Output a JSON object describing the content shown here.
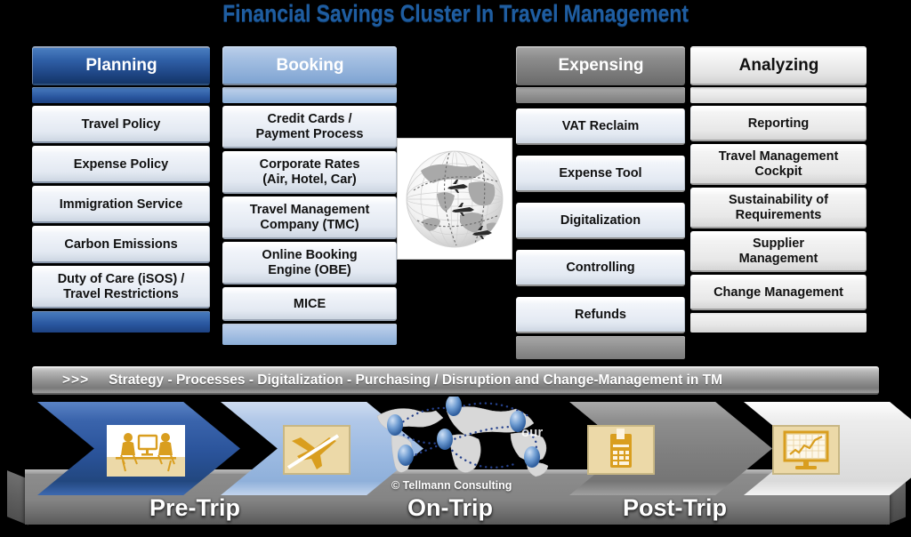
{
  "title": "Financial Savings Cluster In Travel Management",
  "columns": [
    {
      "key": "planning",
      "header": "Planning",
      "accent": "#2f5fa6",
      "items": [
        "Travel Policy",
        "Expense Policy",
        "Immigration Service",
        "Carbon Emissions",
        "Duty of Care (iSOS) /\nTravel Restrictions"
      ]
    },
    {
      "key": "booking",
      "header": "Booking",
      "accent": "#8fb0d9",
      "items": [
        "Credit Cards /\nPayment Process",
        "Corporate Rates\n(Air, Hotel, Car)",
        "Travel Management\nCompany (TMC)",
        "Online Booking\nEngine (OBE)",
        "MICE"
      ]
    },
    {
      "key": "expensing",
      "header": "Expensing",
      "accent": "#7a7a7a",
      "items": [
        "VAT Reclaim",
        "Expense Tool",
        "Digitalization",
        "Controlling",
        "Refunds"
      ]
    },
    {
      "key": "analyzing",
      "header": "Analyzing",
      "accent": "#e4e4e4",
      "items": [
        "Reporting",
        "Travel Management\nCockpit",
        "Sustainability of\nRequirements",
        "Supplier\nManagement",
        "Change Management"
      ]
    }
  ],
  "banner": {
    "arrows": ">>>",
    "text": "Strategy - Processes - Digitalization - Purchasing / Disruption and Change-Management in TM"
  },
  "globe": {
    "icon": "globe-airplanes-icon"
  },
  "phases": [
    {
      "key": "pre-trip",
      "label": "Pre-Trip",
      "color": "#2a539a",
      "icon": "meeting-table-icon"
    },
    {
      "key": "booking-flight",
      "label": "",
      "color": "#9cbae2",
      "icon": "airplane-icon"
    },
    {
      "key": "on-trip",
      "label": "On-Trip",
      "color": "transparent",
      "icon": "world-map-network-icon"
    },
    {
      "key": "expensing-phase",
      "label": "Post-Trip",
      "color": "#7f7f7f",
      "icon": "calculator-receipt-icon"
    },
    {
      "key": "analyzing-phase",
      "label": "",
      "color": "#e2e2e2",
      "icon": "monitor-chart-icon"
    }
  ],
  "copyright": "© Tellmann Consulting",
  "faded_text": "our",
  "colors": {
    "title": "#1F5DA0",
    "planning": "#2f5fa6",
    "booking": "#8fb0d9",
    "expensing": "#7a7a7a",
    "analyzing": "#e4e4e4",
    "icon_gold": "#d99e1f",
    "icon_card_bg": "#ecd9a8",
    "background": "#000000"
  }
}
